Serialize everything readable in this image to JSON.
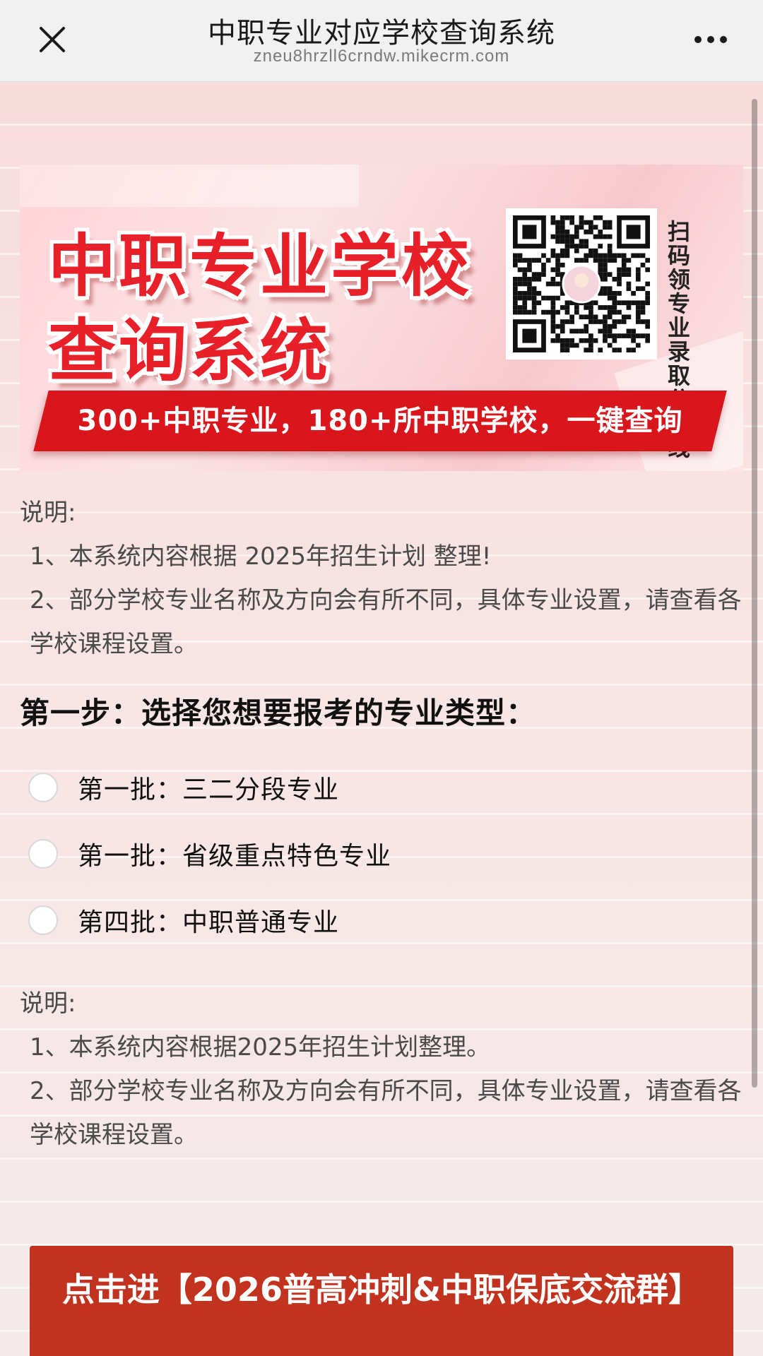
{
  "topbar": {
    "title": "中职专业对应学校查询系统",
    "domain": "zneu8hrzll6crndw.mikecrm.com"
  },
  "banner": {
    "headline_line1": "中职专业学校",
    "headline_line2": "查询系统",
    "qr_caption": "扫码领专业录取分数线",
    "ribbon": "300+中职专业，180+所中职学校，一键查询"
  },
  "intro": {
    "heading": "说明:",
    "line1": "1、本系统内容根据 2025年招生计划 整理!",
    "line2": "2、部分学校专业名称及方向会有所不同，具体专业设置，请查看各学校课程设置。"
  },
  "step": {
    "title": "第一步：选择您想要报考的专业类型：",
    "options": [
      {
        "label": "第一批：三二分段专业"
      },
      {
        "label": "第一批：省级重点特色专业"
      },
      {
        "label": "第四批：中职普通专业"
      }
    ]
  },
  "notes": {
    "heading": "说明:",
    "line1": "1、本系统内容根据2025年招生计划整理。",
    "line2": "2、部分学校专业名称及方向会有所不同，具体专业设置，请查看各学校课程设置。"
  },
  "cta": {
    "label": "点击进【2026普高冲刺&中职保底交流群】"
  },
  "colors": {
    "brand_red": "#e8202a",
    "ribbon_red": "#d9161c",
    "cta_red": "#c1331f"
  },
  "icons": {
    "close": "close-icon",
    "more": "more-icon",
    "qr": "qr-code-icon"
  }
}
